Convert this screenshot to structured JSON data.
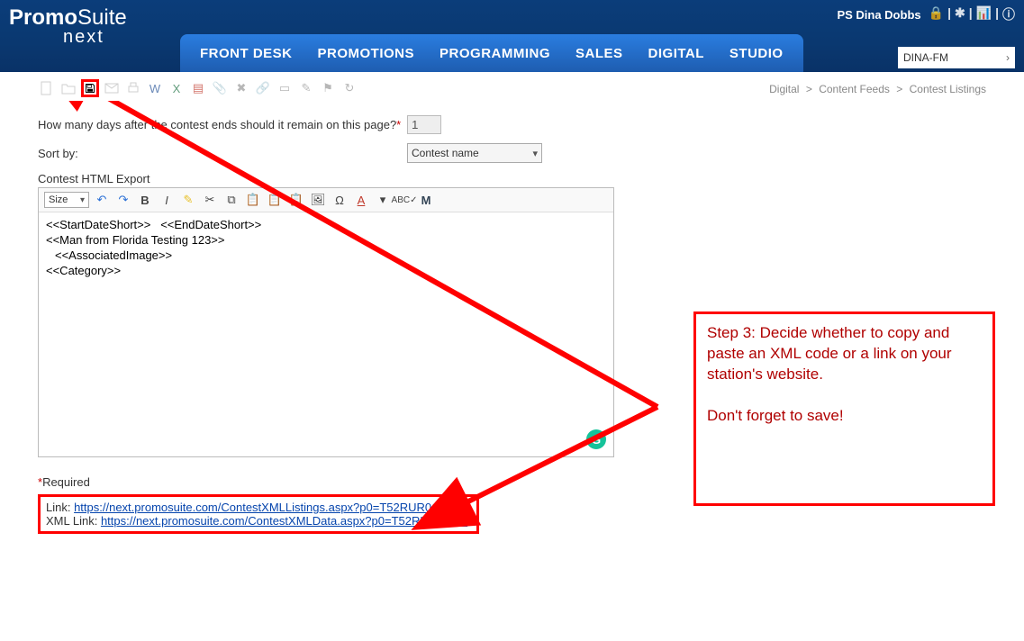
{
  "header": {
    "logo_line1a": "Promo",
    "logo_line1b": "Suite",
    "logo_line2": "next",
    "user_label": "PS Dina Dobbs",
    "nav": [
      "FRONT DESK",
      "PROMOTIONS",
      "PROGRAMMING",
      "SALES",
      "DIGITAL",
      "STUDIO"
    ],
    "station": "DINA-FM"
  },
  "breadcrumb": [
    "Digital",
    "Content Feeds",
    "Contest Listings"
  ],
  "form": {
    "days_label": "How many days after the contest ends should it remain on this page?",
    "days_value": "1",
    "sort_label": "Sort by:",
    "sort_value": "Contest name"
  },
  "editor": {
    "section_label": "Contest HTML Export",
    "size_label": "Size",
    "line1a": "<<StartDateShort>>",
    "line1b": "<<EndDateShort>>",
    "line2": "<<Man from Florida Testing 123>>",
    "line3": "<<AssociatedImage>>",
    "line4": "<<Category>>"
  },
  "footer": {
    "required_marker": "*",
    "required_text": "Required",
    "link_label": "Link: ",
    "link_url": "https://next.promosuite.com/ContestXMLListings.aspx?p0=T52RUR0GLN",
    "xml_label": "XML Link: ",
    "xml_url": "https://next.promosuite.com/ContestXMLData.aspx?p0=T52RUR0GLN"
  },
  "callout": {
    "para1": "Step 3: Decide whether to copy and paste an XML code or a link on your station's website.",
    "para2": "Don't forget to save!"
  }
}
